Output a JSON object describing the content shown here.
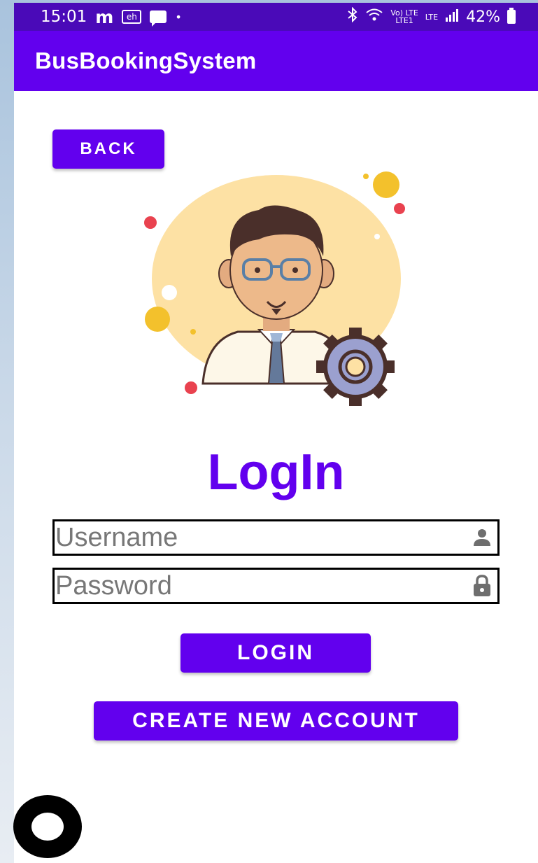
{
  "status_bar": {
    "time": "15:01",
    "icon_m": "m",
    "icon_eh": "eh",
    "dot": "•",
    "network_top": "Vo) LTE",
    "network_bottom": "LTE1",
    "lte": "LTE",
    "battery_percent": "42%"
  },
  "app_bar": {
    "title": "BusBookingSystem"
  },
  "back_button": {
    "label": "Back"
  },
  "heading": "LogIn",
  "username": {
    "placeholder": "Username",
    "icon": "person-icon"
  },
  "password": {
    "placeholder": "Password",
    "icon": "lock-icon"
  },
  "login_button": {
    "label": "Login"
  },
  "create_account_button": {
    "label": "Create new account"
  },
  "colors": {
    "primary": "#6200ee",
    "status_bar": "#4a0ab8",
    "avatar_bg": "#fde1a4"
  }
}
